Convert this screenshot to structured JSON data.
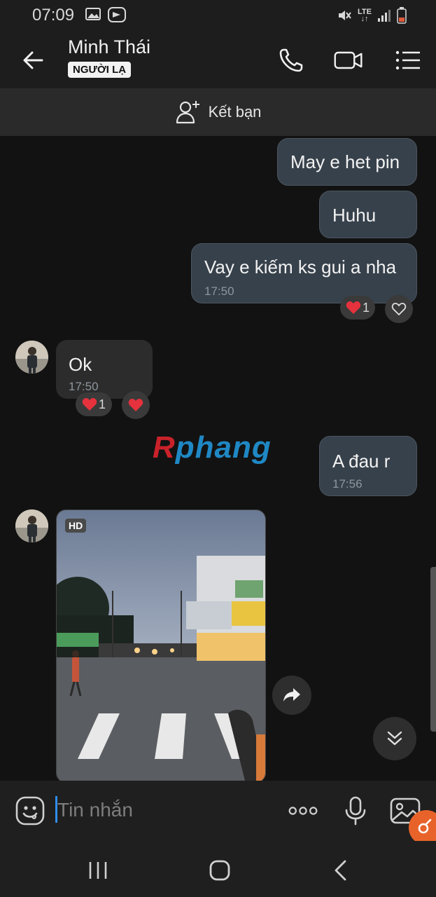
{
  "status": {
    "time": "07:09",
    "network": "LTE"
  },
  "header": {
    "name": "Minh Thái",
    "badge": "NGƯỜI LẠ"
  },
  "add_friend": {
    "label": "Kết bạn"
  },
  "messages": [
    {
      "direction": "out",
      "text": "May e het pin",
      "time": ""
    },
    {
      "direction": "out",
      "text": "Huhu",
      "time": ""
    },
    {
      "direction": "out",
      "text": "Vay e kiếm ks gui a nha",
      "time": "17:50",
      "reaction_count": "1"
    },
    {
      "direction": "in",
      "text": "Ok",
      "time": "17:50",
      "reaction_count": "1"
    },
    {
      "direction": "out",
      "text": "A đau r",
      "time": "17:56"
    },
    {
      "direction": "in",
      "type": "photo",
      "badge": "HD"
    }
  ],
  "watermark": {
    "first": "R",
    "rest": "phang"
  },
  "input": {
    "placeholder": "Tin nhắn"
  },
  "colors": {
    "out_bubble": "#37414b",
    "in_bubble": "#2c2c2c",
    "heart": "#e5323d",
    "accent": "#2f8ef0"
  },
  "icons": [
    "back-arrow-icon",
    "phone-icon",
    "video-icon",
    "menu-list-icon",
    "add-user-icon",
    "heart-icon",
    "forward-icon",
    "scroll-down-icon",
    "emoji-icon",
    "more-icon",
    "mic-icon",
    "gallery-icon"
  ]
}
